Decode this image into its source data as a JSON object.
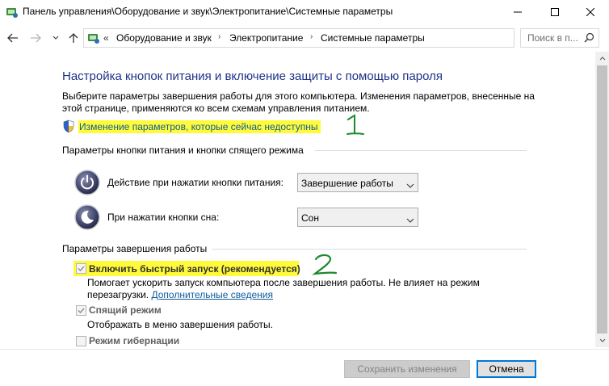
{
  "window": {
    "title": "Панель управления\\Оборудование и звук\\Электропитание\\Системные параметры",
    "icon": "control-panel-icon"
  },
  "nav": {
    "breadcrumb_prefix": "«",
    "breadcrumbs": [
      "Оборудование и звук",
      "Электропитание",
      "Системные параметры"
    ],
    "search_placeholder": "Поиск в п..."
  },
  "content": {
    "heading": "Настройка кнопок питания и включение защиты с помощью пароля",
    "description": "Выберите параметры завершения работы для этого компьютера. Изменения параметров, внесенные на этой странице, применяются ко всем схемам управления питанием.",
    "change_link": "Изменение параметров, которые сейчас недоступны",
    "group_buttons_label": "Параметры кнопки питания и кнопки спящего режима",
    "power_button_label": "Действие при нажатии кнопки питания:",
    "power_button_value": "Завершение работы",
    "sleep_button_label": "При нажатии кнопки сна:",
    "sleep_button_value": "Сон",
    "group_shutdown_label": "Параметры завершения работы",
    "fast_startup": {
      "label": "Включить быстрый запуск (рекомендуется)",
      "checked": true,
      "desc_line1": "Помогает ускорить запуск компьютера после завершения работы. Не влияет на режим",
      "desc_line2_prefix": "перезагрузки.",
      "desc_link": "Дополнительные сведения"
    },
    "sleep_mode": {
      "label": "Спящий режим",
      "checked": true,
      "desc": "Отображать в меню завершения работы."
    },
    "hibernate": {
      "label": "Режим гибернации",
      "checked": false
    }
  },
  "annotations": [
    "1",
    "2"
  ],
  "buttons": {
    "save": "Сохранить изменения",
    "cancel": "Отмена"
  },
  "colors": {
    "heading": "#1e3287",
    "link": "#0f5b9a",
    "highlight": "#fffb3a",
    "annotation": "#1a8a2a"
  }
}
